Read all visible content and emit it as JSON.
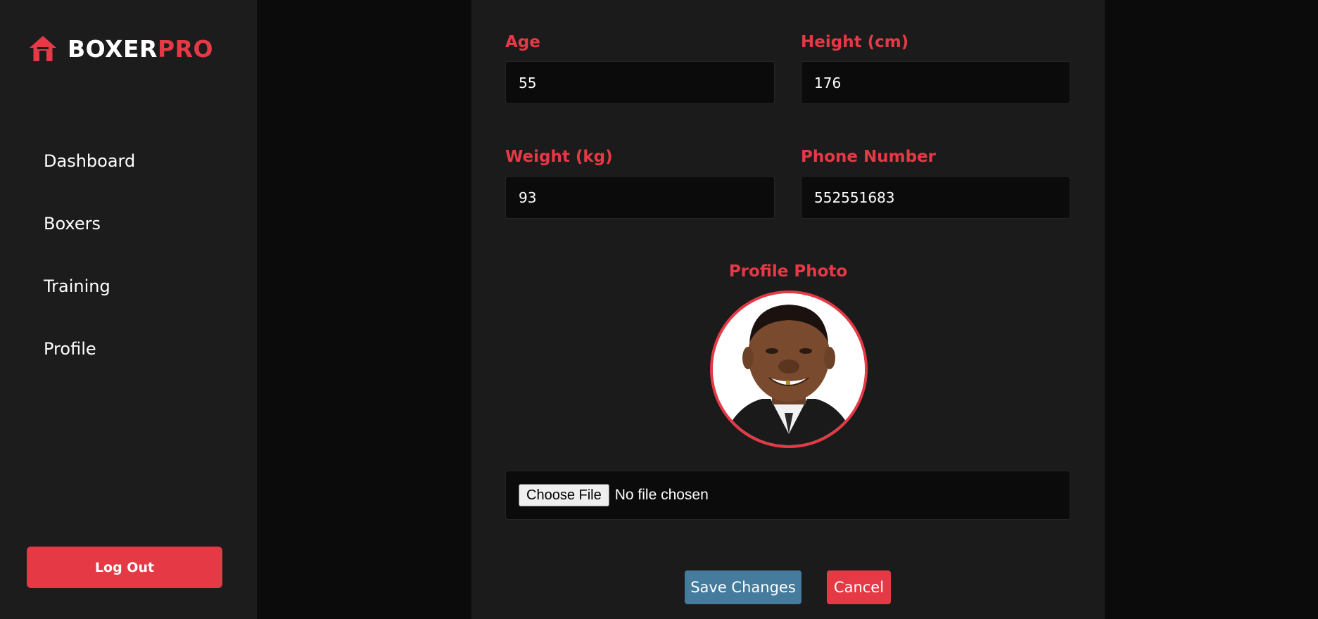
{
  "brand": {
    "name_part1": "BOXER",
    "name_part2": "PRO",
    "icon": "home-icon",
    "accent_color": "#e63946"
  },
  "sidebar": {
    "items": [
      {
        "label": "Dashboard"
      },
      {
        "label": "Boxers"
      },
      {
        "label": "Training"
      },
      {
        "label": "Profile"
      }
    ],
    "logout_label": "Log Out"
  },
  "form": {
    "age": {
      "label": "Age",
      "value": "55"
    },
    "height": {
      "label": "Height (cm)",
      "value": "176"
    },
    "weight": {
      "label": "Weight (kg)",
      "value": "93"
    },
    "phone": {
      "label": "Phone Number",
      "value": "552551683"
    },
    "photo": {
      "label": "Profile Photo",
      "choose_label": "Choose File",
      "status": "No file chosen"
    },
    "save_label": "Save Changes",
    "cancel_label": "Cancel",
    "save_color": "#457b9d"
  }
}
